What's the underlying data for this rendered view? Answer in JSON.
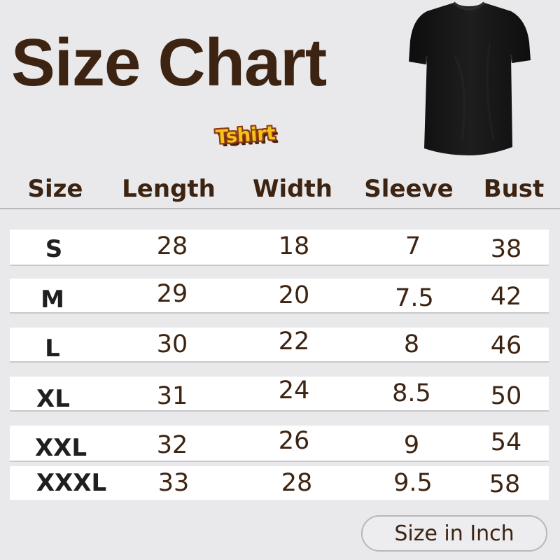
{
  "header": {
    "title": "Size Chart",
    "badge": "Tshirt"
  },
  "table": {
    "columns": [
      "Size",
      "Length",
      "Width",
      "Sleeve",
      "Bust"
    ],
    "rows": [
      {
        "size": "S",
        "length": "28",
        "width": "18",
        "sleeve": "7",
        "bust": "38"
      },
      {
        "size": "M",
        "length": "29",
        "width": "20",
        "sleeve": "7.5",
        "bust": "42"
      },
      {
        "size": "L",
        "length": "30",
        "width": "22",
        "sleeve": "8",
        "bust": "46"
      },
      {
        "size": "XL",
        "length": "31",
        "width": "24",
        "sleeve": "8.5",
        "bust": "50"
      },
      {
        "size": "XXL",
        "length": "32",
        "width": "26",
        "sleeve": "9",
        "bust": "54"
      },
      {
        "size": "XXXL",
        "length": "33",
        "width": "28",
        "sleeve": "9.5",
        "bust": "58"
      }
    ]
  },
  "footer": {
    "unit_label": "Size in Inch"
  },
  "colors": {
    "background": "#e9e9eb",
    "title_brown": "#3d2412",
    "row_background": "#ffffff",
    "badge_yellow": "#f7c21a",
    "badge_outline": "#8a3a12"
  },
  "images": {
    "tshirt": "black-tshirt-photo"
  }
}
